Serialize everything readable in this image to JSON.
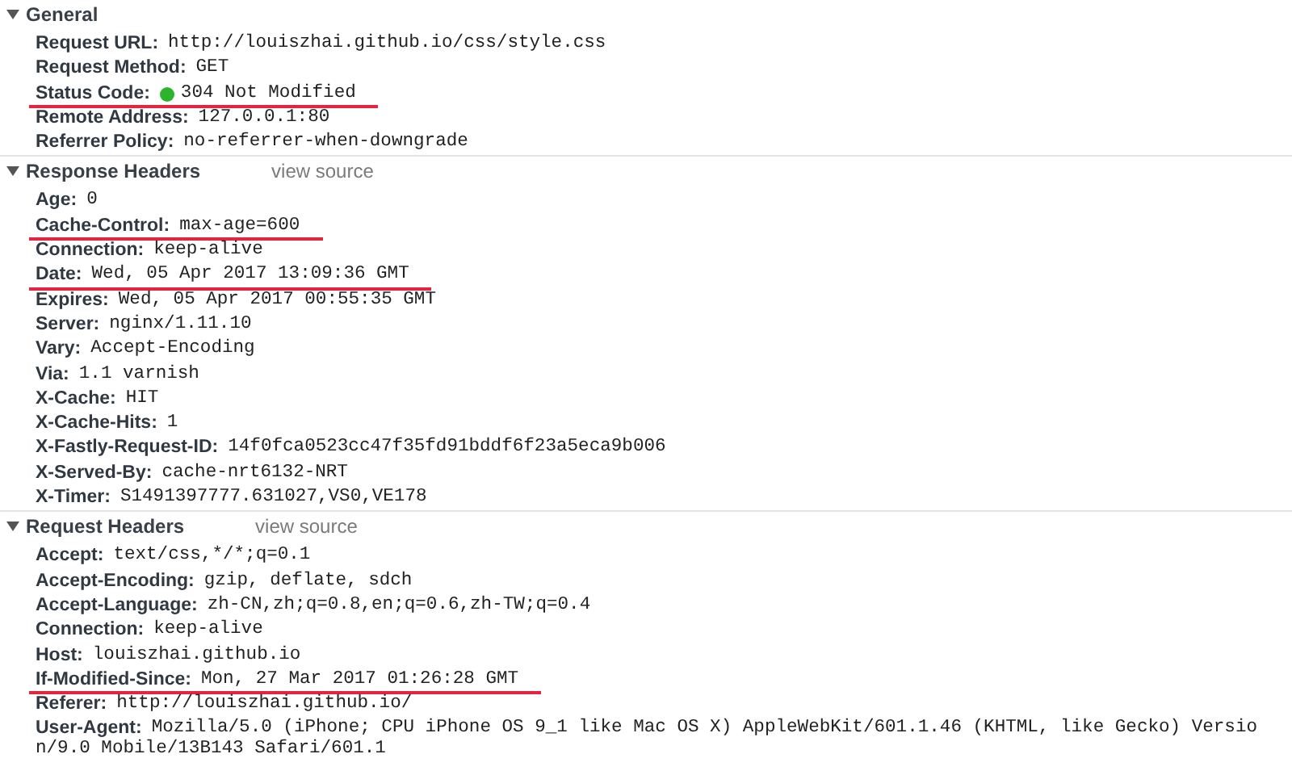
{
  "sections": [
    {
      "title": "General",
      "expanded": true,
      "rows": [
        {
          "name": "Request URL:",
          "value": "http://louiszhai.github.io/css/style.css",
          "underlined": false
        },
        {
          "name": "Request Method:",
          "value": "GET",
          "underlined": false
        },
        {
          "name": "Status Code:",
          "value": "304 Not Modified",
          "underlined": true,
          "status_dot": {
            "color": "#2cb52c"
          }
        },
        {
          "name": "Remote Address:",
          "value": "127.0.0.1:80",
          "underlined": false
        },
        {
          "name": "Referrer Policy:",
          "value": "no-referrer-when-downgrade",
          "underlined": false
        }
      ]
    },
    {
      "title": "Response Headers",
      "expanded": true,
      "link": "view source",
      "rows": [
        {
          "name": "Age:",
          "value": "0",
          "underlined": false
        },
        {
          "name": "Cache-Control:",
          "value": "max-age=600",
          "underlined": true
        },
        {
          "name": "Connection:",
          "value": "keep-alive",
          "underlined": false
        },
        {
          "name": "Date:",
          "value": "Wed, 05 Apr 2017 13:09:36 GMT",
          "underlined": true
        },
        {
          "name": "Expires:",
          "value": "Wed, 05 Apr 2017 00:55:35 GMT",
          "underlined": false
        },
        {
          "name": "Server:",
          "value": "nginx/1.11.10",
          "underlined": false
        },
        {
          "name": "Vary:",
          "value": "Accept-Encoding",
          "underlined": false
        },
        {
          "name": "Via:",
          "value": "1.1 varnish",
          "underlined": false
        },
        {
          "name": "X-Cache:",
          "value": "HIT",
          "underlined": false
        },
        {
          "name": "X-Cache-Hits:",
          "value": "1",
          "underlined": false
        },
        {
          "name": "X-Fastly-Request-ID:",
          "value": "14f0fca0523cc47f35fd91bddf6f23a5eca9b006",
          "underlined": false
        },
        {
          "name": "X-Served-By:",
          "value": "cache-nrt6132-NRT",
          "underlined": false
        },
        {
          "name": "X-Timer:",
          "value": "S1491397777.631027,VS0,VE178",
          "underlined": false
        }
      ]
    },
    {
      "title": "Request Headers",
      "expanded": true,
      "link": "view source",
      "rows": [
        {
          "name": "Accept:",
          "value": "text/css,*/*;q=0.1",
          "underlined": false
        },
        {
          "name": "Accept-Encoding:",
          "value": "gzip, deflate, sdch",
          "underlined": false
        },
        {
          "name": "Accept-Language:",
          "value": "zh-CN,zh;q=0.8,en;q=0.6,zh-TW;q=0.4",
          "underlined": false
        },
        {
          "name": "Connection:",
          "value": "keep-alive",
          "underlined": false
        },
        {
          "name": "Host:",
          "value": "louiszhai.github.io",
          "underlined": false
        },
        {
          "name": "If-Modified-Since:",
          "value": "Mon, 27 Mar 2017 01:26:28 GMT",
          "underlined": true
        },
        {
          "name": "Referer:",
          "value": "http://louiszhai.github.io/",
          "underlined": false
        },
        {
          "name": "User-Agent:",
          "value": "Mozilla/5.0 (iPhone; CPU iPhone OS 9_1 like Mac OS X) AppleWebKit/601.1.46 (KHTML, like Gecko) Versio",
          "continuation": "n/9.0 Mobile/13B143 Safari/601.1",
          "underlined": false
        }
      ]
    }
  ]
}
